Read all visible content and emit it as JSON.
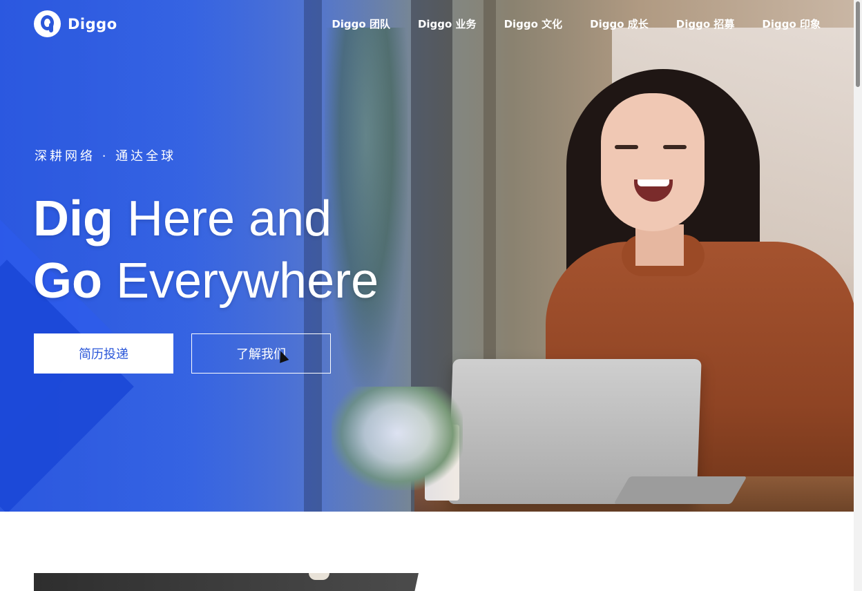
{
  "brand": {
    "name": "Diggo"
  },
  "nav": {
    "items": [
      {
        "label": "Diggo 团队"
      },
      {
        "label": "Diggo 业务"
      },
      {
        "label": "Diggo 文化"
      },
      {
        "label": "Diggo 成长"
      },
      {
        "label": "Diggo 招募"
      },
      {
        "label": "Diggo 印象"
      }
    ]
  },
  "hero": {
    "tagline": "深耕网络 · 通达全球",
    "headline": {
      "line1_bold": "Dig",
      "line1_rest": " Here and",
      "line2_bold": "Go",
      "line2_rest": " Everywhere"
    },
    "buttons": {
      "primary": "简历投递",
      "secondary": "了解我们"
    }
  },
  "colors": {
    "accent": "#2b57d9",
    "text_on_hero": "#ffffff"
  }
}
